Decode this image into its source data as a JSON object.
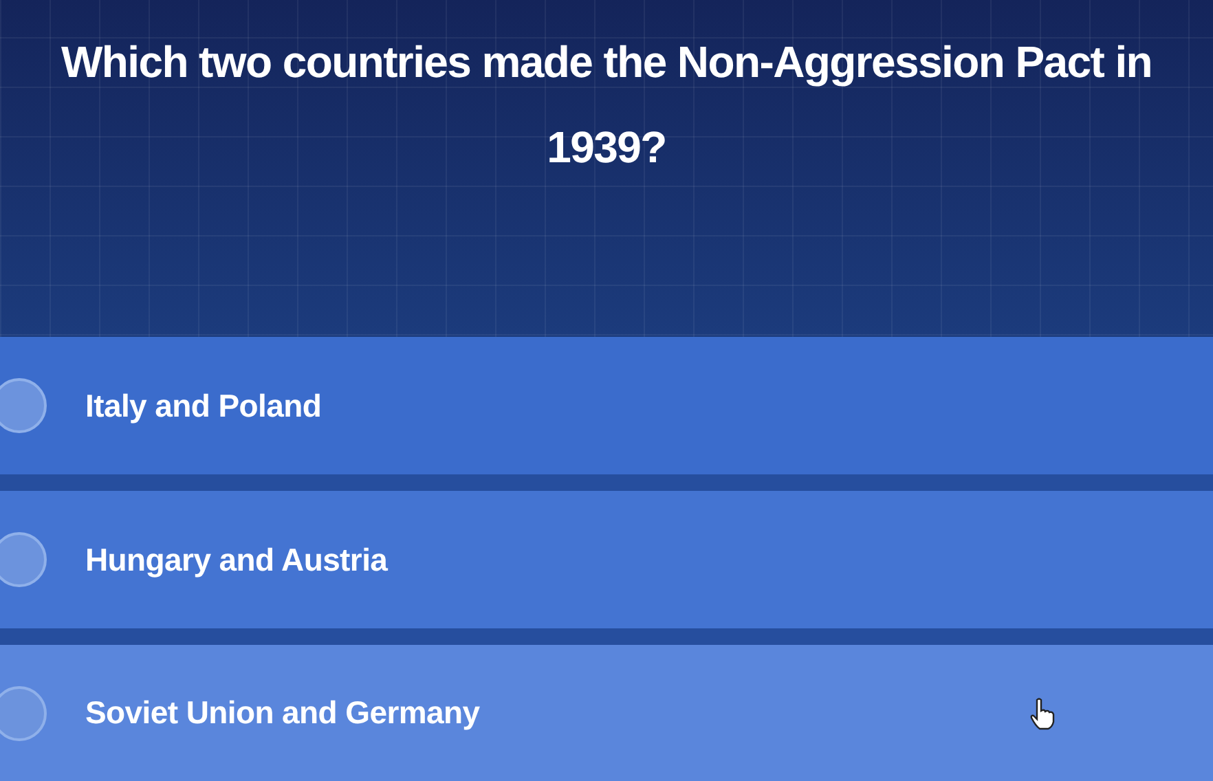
{
  "question": "Which two countries made the Non-Aggression Pact in 1939?",
  "options": [
    {
      "label": "Italy and Poland",
      "selected": false
    },
    {
      "label": "Hungary and Austria",
      "selected": false
    },
    {
      "label": "Soviet Union and Germany",
      "selected": false
    }
  ]
}
